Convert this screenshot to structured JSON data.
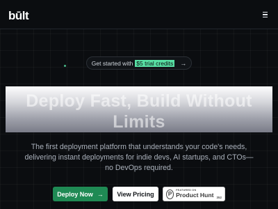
{
  "header": {
    "logo": "būlt",
    "menu_icon": "hamburger-menu-icon"
  },
  "announcement": {
    "prefix": "Get started with",
    "highlight": "$5 trial credits",
    "arrow": "→",
    "accent_color": "#58e0a4"
  },
  "hero": {
    "title": "Deploy Fast, Build Without Limits"
  },
  "subtitle": "The first deployment platform that understands your code's needs, delivering instant deployments for indie devs, AI startups, and CTOs—no DevOps required.",
  "actions": {
    "primary_label": "Deploy Now",
    "primary_arrow": "→",
    "primary_color": "#1f8a54",
    "secondary_label": "View Pricing",
    "product_hunt": {
      "featured_label": "FEATURED ON",
      "name": "Product Hunt",
      "count": "352",
      "badge_letter": "P"
    }
  }
}
